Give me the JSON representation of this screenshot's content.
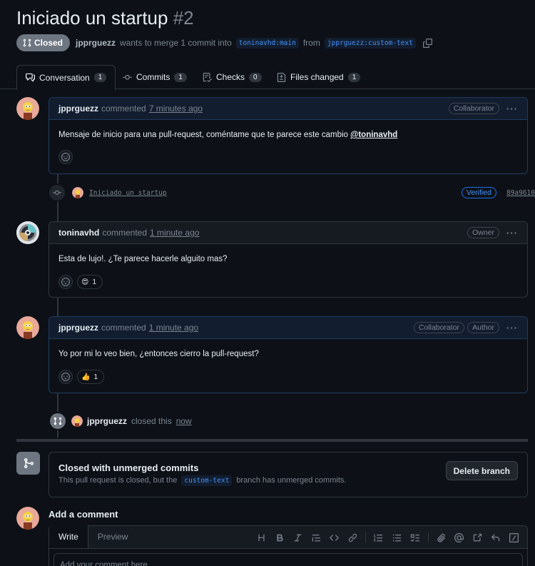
{
  "pr": {
    "title": "Iniciado un startup",
    "number": "#2",
    "state": "Closed",
    "author": "jpprguezz",
    "merge_text_1": "wants to merge 1 commit into",
    "base_branch": "toninavhd:main",
    "from_text": "from",
    "head_branch": "jpprguezz:custom-text"
  },
  "tabs": [
    {
      "label": "Conversation",
      "count": "1"
    },
    {
      "label": "Commits",
      "count": "1"
    },
    {
      "label": "Checks",
      "count": "0"
    },
    {
      "label": "Files changed",
      "count": "1"
    }
  ],
  "comments": [
    {
      "author": "jpprguezz",
      "verb": "commented",
      "time": "7 minutes ago",
      "badges": [
        "Collaborator"
      ],
      "body": "Mensaje de inicio para una pull-request, coméntame que te parece este cambio",
      "mention": "@toninavhd"
    },
    {
      "author": "toninavhd",
      "verb": "commented",
      "time": "1 minute ago",
      "badges": [
        "Owner"
      ],
      "body": "Esta de lujo!. ¿Te parece hacerle alguito mas?",
      "reaction": {
        "emoji": "😍",
        "count": "1"
      }
    },
    {
      "author": "jpprguezz",
      "verb": "commented",
      "time": "1 minute ago",
      "badges": [
        "Collaborator",
        "Author"
      ],
      "body": "Yo por mi lo veo bien, ¿entonces cierro la pull-request?",
      "reaction": {
        "emoji": "👍",
        "count": "1"
      }
    }
  ],
  "commit": {
    "message": "Iniciado un startup",
    "verified": "Verified",
    "sha": "89a9610"
  },
  "closed_event": {
    "actor": "jpprguezz",
    "text": "closed this",
    "time": "now"
  },
  "merge_box": {
    "title": "Closed with unmerged commits",
    "sub_1": "This pull request is closed, but the",
    "branch": "custom-text",
    "sub_2": "branch has unmerged commits.",
    "delete_label": "Delete branch"
  },
  "add_comment": {
    "title": "Add a comment",
    "write_tab": "Write",
    "preview_tab": "Preview",
    "placeholder": "Add your comment here..."
  },
  "colors": {
    "background": "#0d1117",
    "closed_gray": "#6e7681",
    "link_blue": "#4493f8",
    "border": "#30363d"
  }
}
